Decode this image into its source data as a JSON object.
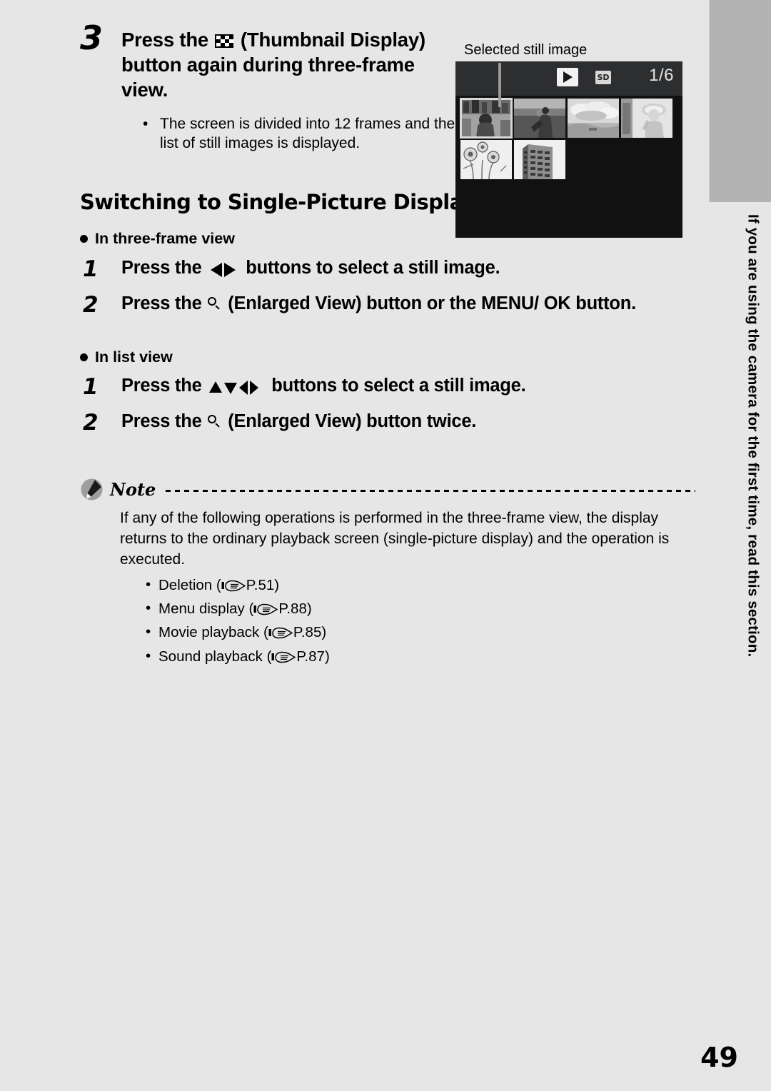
{
  "page": {
    "number": "49",
    "background_color": "#e6e6e6",
    "edge_tab_color": "#b3b3b3"
  },
  "side_caption": {
    "text": "If you are using the camera for the first time, read this section."
  },
  "step_main": {
    "number": "3",
    "title_before_icon": "Press the ",
    "icon": "thumbnail-display-icon",
    "title_after_icon": " (Thumbnail Display) button again during three-frame view.",
    "bullet": "•",
    "bullet_text": "The screen is divided into 12 frames and the list of still images is displayed."
  },
  "figure": {
    "caption": "Selected still image",
    "lcd": {
      "play_icon": "play-icon",
      "card_icon_label": "SD",
      "frame_counter": "1/6",
      "thumbnails": [
        {
          "name": "indoor-people-photo",
          "selected": true
        },
        {
          "name": "beach-person-photo",
          "selected": false
        },
        {
          "name": "landscape-clouds-photo",
          "selected": false
        },
        {
          "name": "portrait-woman-photo",
          "selected": false
        },
        {
          "name": "flowers-photo",
          "selected": false
        },
        {
          "name": "building-photo",
          "selected": false
        }
      ]
    }
  },
  "section": {
    "heading": "Switching to Single-Picture Display"
  },
  "three_frame": {
    "subheading": "In three-frame view",
    "steps": [
      {
        "number": "1",
        "before": "Press the ",
        "icon": "left-right-arrows-icon",
        "after": " buttons to select a still image."
      },
      {
        "number": "2",
        "before": "Press the ",
        "icon": "magnifier-icon",
        "after": " (Enlarged View) button or the MENU/ OK button."
      }
    ]
  },
  "list_view": {
    "subheading": "In list view",
    "steps": [
      {
        "number": "1",
        "before": "Press the ",
        "icon": "up-down-left-right-arrows-icon",
        "after": " buttons to select a still image."
      },
      {
        "number": "2",
        "before": "Press the ",
        "icon": "magnifier-icon",
        "after": " (Enlarged View) button twice."
      }
    ]
  },
  "note": {
    "icon": "note-pencil-icon",
    "label": "Note",
    "body": "If any of the following operations is performed in the three-frame view, the display returns to the ordinary playback screen (single-picture display) and the operation is executed.",
    "items": [
      {
        "bullet": "•",
        "label": "Deletion (",
        "ref_icon": "pointing-hand-icon",
        "page": "P.51",
        "close": ")"
      },
      {
        "bullet": "•",
        "label": "Menu display (",
        "ref_icon": "pointing-hand-icon",
        "page": "P.88",
        "close": ")"
      },
      {
        "bullet": "•",
        "label": "Movie playback (",
        "ref_icon": "pointing-hand-icon",
        "page": "P.85",
        "close": ")"
      },
      {
        "bullet": "•",
        "label": "Sound playback (",
        "ref_icon": "pointing-hand-icon",
        "page": "P.87",
        "close": ")"
      }
    ]
  }
}
